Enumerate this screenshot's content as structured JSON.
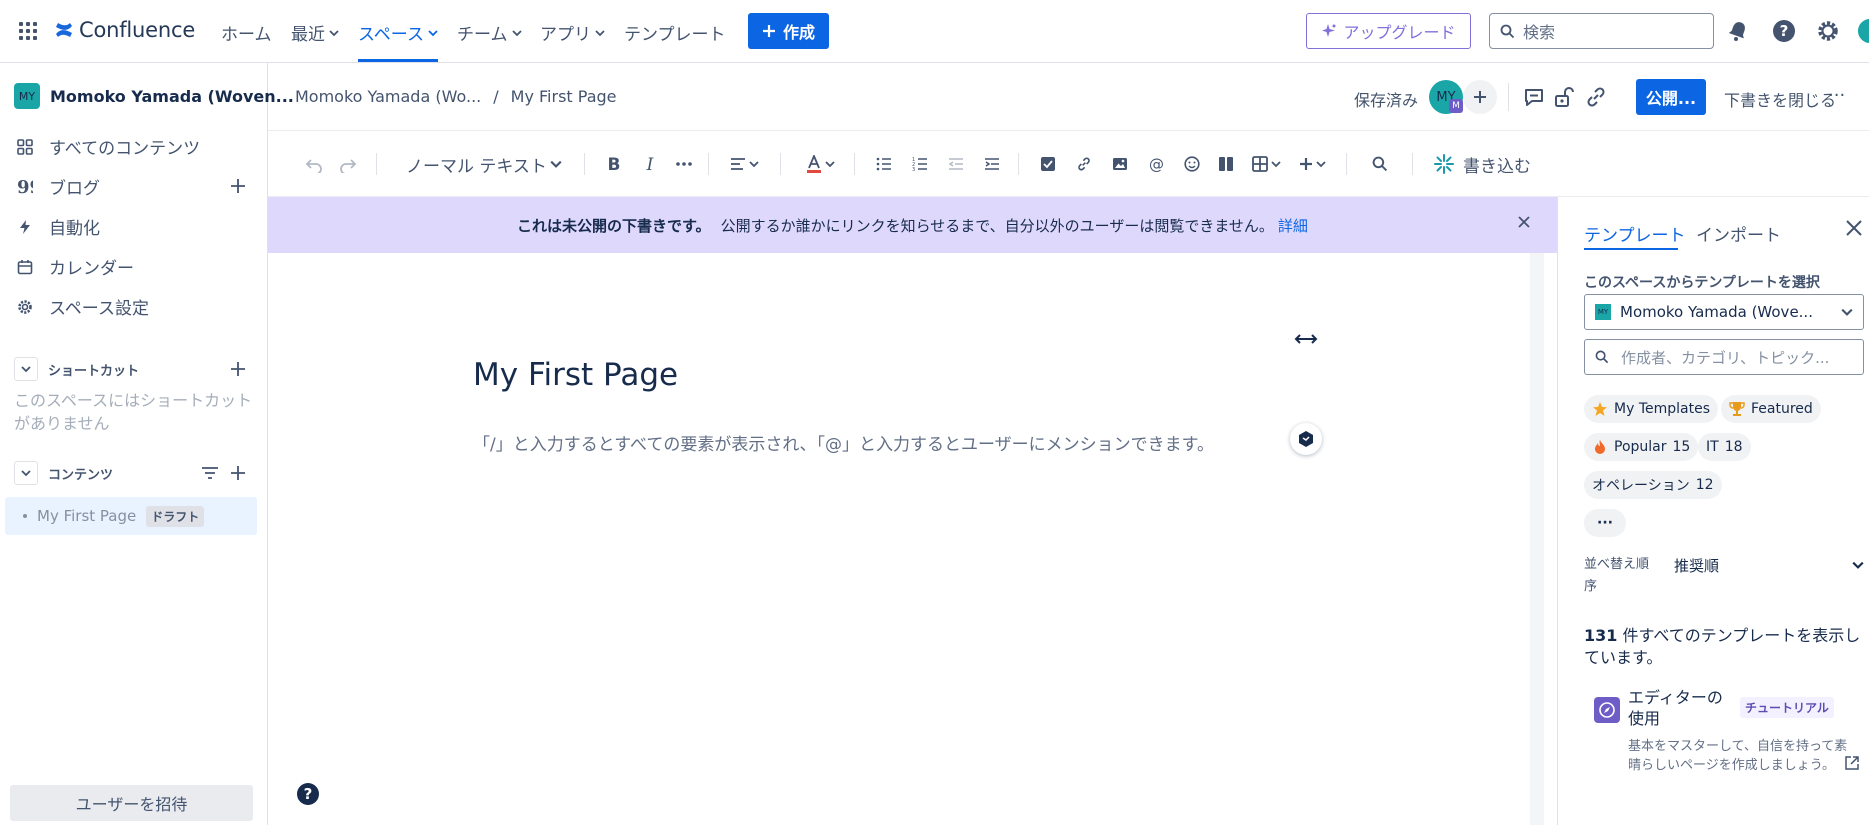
{
  "topnav": {
    "logo_text": "Confluence",
    "items": [
      {
        "label": "ホーム"
      },
      {
        "label": "最近"
      },
      {
        "label": "スペース"
      },
      {
        "label": "チーム"
      },
      {
        "label": "アプリ"
      },
      {
        "label": "テンプレート"
      }
    ],
    "create_label": "作成",
    "upgrade_label": "アップグレード",
    "search_placeholder": "検索"
  },
  "sidebar": {
    "space_avatar": "MY",
    "space_name": "Momoko Yamada (Woven...",
    "items": [
      {
        "label": "すべてのコンテンツ"
      },
      {
        "label": "ブログ"
      },
      {
        "label": "自動化"
      },
      {
        "label": "カレンダー"
      },
      {
        "label": "スペース設定"
      }
    ],
    "shortcuts_label": "ショートカット",
    "shortcuts_empty": "このスペースにはショートカットがありません",
    "content_label": "コンテンツ",
    "tree_item": "My First Page",
    "draft_tag": "ドラフト",
    "invite_label": "ユーザーを招待"
  },
  "pageheader": {
    "breadcrumb_space": "Momoko Yamada (Wo...",
    "breadcrumb_sep": "/",
    "breadcrumb_page": "My First Page",
    "saved_label": "保存済み",
    "avatar": "MY",
    "avatar_badge": "M",
    "publish_label": "公開...",
    "close_draft_label": "下書きを閉じる",
    "more": "···"
  },
  "toolbar": {
    "text_style": "ノーマル テキスト",
    "write_label": "書き込む"
  },
  "banner": {
    "bold": "これは未公開の下書きです。",
    "text": "公開するか誰かにリンクを知らせるまで、自分以外のユーザーは閲覧できません。",
    "link": "詳細"
  },
  "editor": {
    "title": "My First Page",
    "placeholder": "「/」と入力するとすべての要素が表示され、「@」と入力するとユーザーにメンションできます。"
  },
  "template_panel": {
    "tab_templates": "テンプレート",
    "tab_import": "インポート",
    "select_label": "このスペースからテンプレートを選択",
    "space_select": "Momoko Yamada (Wove...",
    "search_placeholder": "作成者、カテゴリ、トピック...",
    "chips": [
      {
        "label": "My Templates",
        "count": ""
      },
      {
        "label": "Featured",
        "count": ""
      },
      {
        "label": "Popular",
        "count": "15"
      },
      {
        "label": "IT",
        "count": "18"
      },
      {
        "label": "オペレーション",
        "count": "12"
      },
      {
        "label": "···",
        "count": ""
      }
    ],
    "sort_label": "並べ替え順序",
    "sort_value": "推奨順",
    "result_count": "131",
    "result_text": "件すべてのテンプレートを表示しています。",
    "template_title": "エディターの使用",
    "template_badge": "チュートリアル",
    "template_desc": "基本をマスターして、自信を持って素晴らしいページを作成しましょう。"
  },
  "colors": {
    "primary": "#0c66e4",
    "banner_bg": "#dfd8fd",
    "upgrade": "#8270db",
    "space_avatar": "#1aa6a6"
  }
}
